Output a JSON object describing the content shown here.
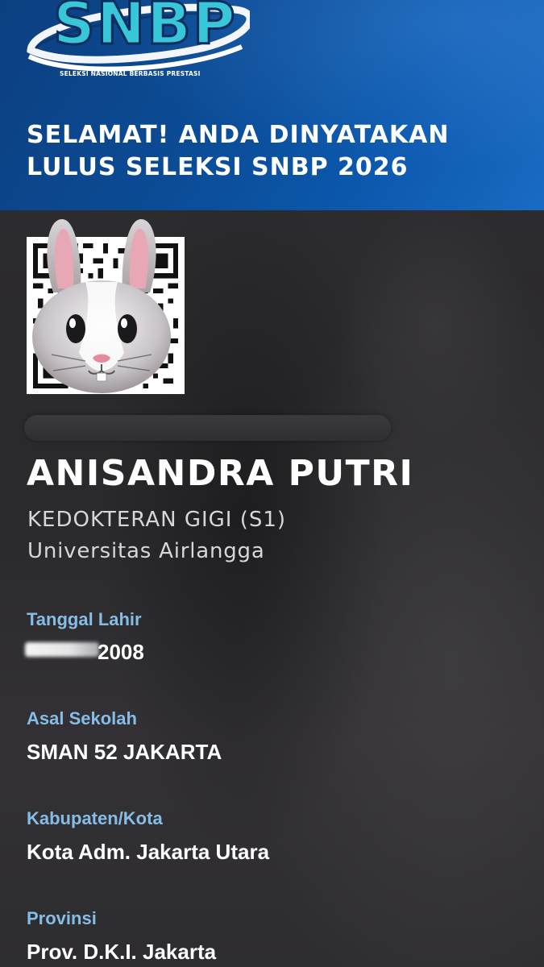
{
  "header": {
    "logo_text": "SNBP",
    "logo_subtitle": "SELEKSI NASIONAL BERBASIS PRESTASI",
    "headline_line1": "SELAMAT! ANDA DINYATAKAN",
    "headline_line2": "LULUS SELEKSI SNBP 2026"
  },
  "participant": {
    "name": "ANISANDRA PUTRI",
    "program": "KEDOKTERAN GIGI (S1)",
    "university": "Universitas Airlangga"
  },
  "fields": {
    "birth_date": {
      "label": "Tanggal Lahir",
      "value_visible": "2008"
    },
    "school": {
      "label": "Asal Sekolah",
      "value": "SMAN 52 JAKARTA"
    },
    "regency": {
      "label": "Kabupaten/Kota",
      "value": "Kota Adm. Jakarta Utara"
    },
    "province": {
      "label": "Provinsi",
      "value": "Prov. D.K.I. Jakarta"
    }
  },
  "colors": {
    "header_blue": "#0b58ad",
    "label_blue": "#86bde6",
    "logo_teal": "#38c6d8",
    "background": "#2b2a2c"
  },
  "icons": {
    "qr": "qr-code-icon",
    "sticker": "bunny-face-emoji-icon"
  }
}
